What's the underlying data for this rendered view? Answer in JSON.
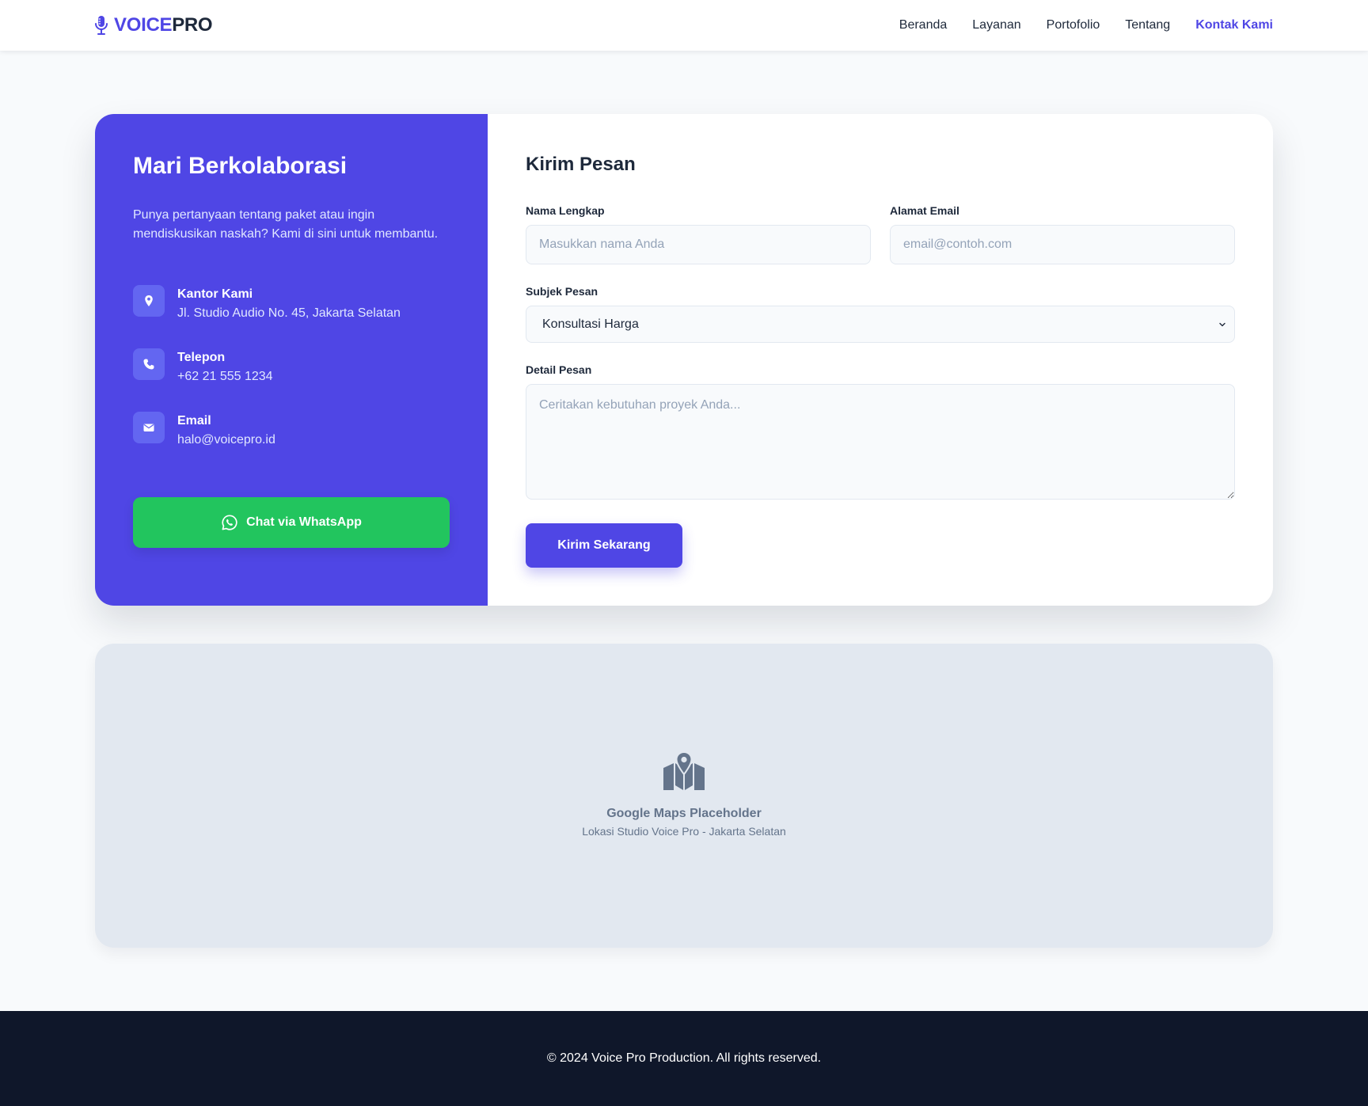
{
  "brand": {
    "name_primary": "VOICE",
    "name_secondary": "PRO",
    "accent_color": "#4f46e5",
    "icon": "microphone-icon"
  },
  "nav": {
    "items": [
      {
        "label": "Beranda",
        "active": false
      },
      {
        "label": "Layanan",
        "active": false
      },
      {
        "label": "Portofolio",
        "active": false
      },
      {
        "label": "Tentang",
        "active": false
      },
      {
        "label": "Kontak Kami",
        "active": true
      }
    ]
  },
  "contact_panel": {
    "title": "Mari Berkolaborasi",
    "description": "Punya pertanyaan tentang paket atau ingin mendiskusikan naskah? Kami di sini untuk membantu.",
    "background_color": "#4f46e5",
    "items": [
      {
        "icon": "map-pin-icon",
        "title": "Kantor Kami",
        "value": "Jl. Studio Audio No. 45, Jakarta Selatan"
      },
      {
        "icon": "phone-icon",
        "title": "Telepon",
        "value": "+62 21 555 1234"
      },
      {
        "icon": "envelope-icon",
        "title": "Email",
        "value": "halo@voicepro.id"
      }
    ],
    "whatsapp_button": {
      "label": "Chat via WhatsApp",
      "icon": "whatsapp-icon",
      "color": "#22c55e"
    }
  },
  "form": {
    "title": "Kirim Pesan",
    "name_field": {
      "label": "Nama Lengkap",
      "placeholder": "Masukkan nama Anda",
      "value": ""
    },
    "email_field": {
      "label": "Alamat Email",
      "placeholder": "email@contoh.com",
      "value": ""
    },
    "subject_field": {
      "label": "Subjek Pesan",
      "selected": "Konsultasi Harga"
    },
    "message_field": {
      "label": "Detail Pesan",
      "placeholder": "Ceritakan kebutuhan proyek Anda...",
      "value": ""
    },
    "submit_label": "Kirim Sekarang"
  },
  "map": {
    "icon": "map-location-icon",
    "title": "Google Maps Placeholder",
    "subtitle": "Lokasi Studio Voice Pro - Jakarta Selatan"
  },
  "footer": {
    "text": "© 2024 Voice Pro Production. All rights reserved.",
    "background_color": "#0f172a"
  }
}
